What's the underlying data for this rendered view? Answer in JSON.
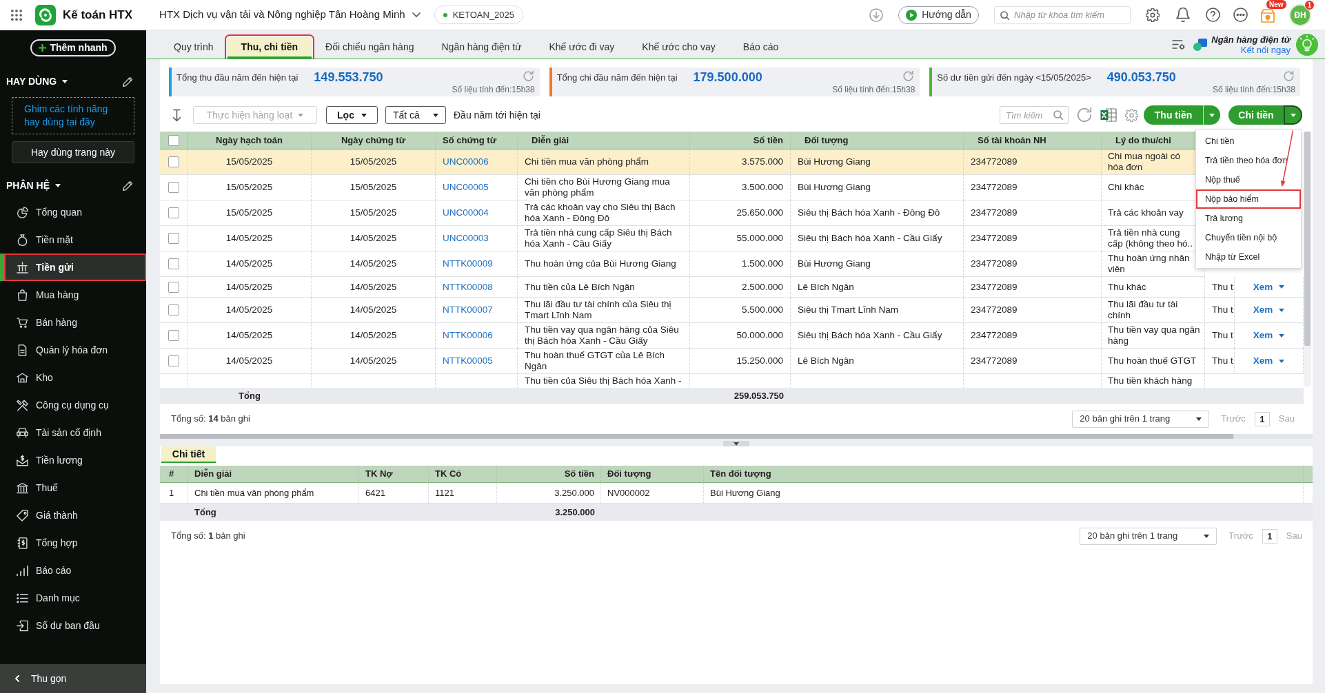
{
  "top_bar": {
    "product_name": "Kế toán HTX",
    "organization": "HTX Dịch vụ vận tải và Nông nghiệp Tân Hoàng Minh",
    "database": "KETOAN_2025",
    "guide_button": "Hướng dẫn",
    "search": {
      "placeholder": "Nhập từ khóa tìm kiếm"
    },
    "new_badge": "New",
    "avatar_initials": "ĐH",
    "notification_count": "1"
  },
  "sidebar": {
    "quick_add_button": "Thêm nhanh",
    "favorites": {
      "title": "HAY DÙNG",
      "hint": "Ghim các tính năng hay dùng tại đây",
      "pin_button": "Hay dùng trang này"
    },
    "modules": {
      "title": "PHÂN HỆ",
      "items": [
        {
          "label": "Tổng quan",
          "selected": false,
          "callout": false
        },
        {
          "label": "Tiền mặt",
          "selected": false,
          "callout": false
        },
        {
          "label": "Tiền gửi",
          "selected": true,
          "callout": true
        },
        {
          "label": "Mua hàng",
          "selected": false,
          "callout": false
        },
        {
          "label": "Bán hàng",
          "selected": false,
          "callout": false
        },
        {
          "label": "Quản lý hóa đơn",
          "selected": false,
          "callout": false
        },
        {
          "label": "Kho",
          "selected": false,
          "callout": false
        },
        {
          "label": "Công cụ dụng cụ",
          "selected": false,
          "callout": false
        },
        {
          "label": "Tài sản cố định",
          "selected": false,
          "callout": false
        },
        {
          "label": "Tiền lương",
          "selected": false,
          "callout": false
        },
        {
          "label": "Thuế",
          "selected": false,
          "callout": false
        },
        {
          "label": "Giá thành",
          "selected": false,
          "callout": false
        },
        {
          "label": "Tổng hợp",
          "selected": false,
          "callout": false
        },
        {
          "label": "Báo cáo",
          "selected": false,
          "callout": false
        },
        {
          "label": "Danh mục",
          "selected": false,
          "callout": false
        },
        {
          "label": "Số dư ban đầu",
          "selected": false,
          "callout": false
        }
      ]
    },
    "collapse_button": "Thu gọn"
  },
  "tabs": [
    {
      "label": "Quy trình",
      "selected": false,
      "callout": false
    },
    {
      "label": "Thu, chi tiền",
      "selected": true,
      "callout": true
    },
    {
      "label": "Đối chiếu ngân hàng",
      "selected": false,
      "callout": false
    },
    {
      "label": "Ngân hàng điện tử",
      "selected": false,
      "callout": false
    },
    {
      "label": "Khế ước đi vay",
      "selected": false,
      "callout": false
    },
    {
      "label": "Khế ước cho vay",
      "selected": false,
      "callout": false
    },
    {
      "label": "Báo cáo",
      "selected": false,
      "callout": false
    }
  ],
  "bank_promo": {
    "title": "Ngân hàng điện tử",
    "link": "Kết nối ngay"
  },
  "summary_cards": [
    {
      "label": "Tổng thu đầu năm đến hiện tại",
      "value": "149.553.750",
      "note": "Số liệu tính đến:15h38",
      "color": "#1ba1e6"
    },
    {
      "label": "Tổng chi đầu năm đến hiện tại",
      "value": "179.500.000",
      "note": "Số liệu tính đến:15h38",
      "color": "#f47b20"
    },
    {
      "label": "Số dư tiền gửi đến ngày <15/05/2025>",
      "value": "490.053.750",
      "note": "Số liệu tính đến:15h38",
      "color": "#4cb82e"
    }
  ],
  "toolbar": {
    "bulk_action": {
      "label": "Thực hiện hàng loạt",
      "disabled": true
    },
    "filter_button": "Lọc",
    "scope_select": "Tất cả",
    "period": "Đầu năm tới hiện tại",
    "search": {
      "placeholder": "Tìm kiếm"
    },
    "receive_button": "Thu tiền",
    "pay_button": {
      "label": "Chi tiền",
      "expanded": true
    }
  },
  "dropdown_menu": {
    "items": [
      {
        "label": "Chi tiền",
        "callout": false
      },
      {
        "label": "Trả tiền theo hóa đơn",
        "callout": false
      },
      {
        "label": "Nộp thuế",
        "callout": false
      },
      {
        "label": "Nộp bảo hiểm",
        "callout": true
      },
      {
        "label": "Trả lương",
        "callout": false
      },
      {
        "label": "Chuyển tiền nội bộ",
        "callout": false
      },
      {
        "label": "Nhập từ Excel",
        "callout": false
      }
    ]
  },
  "table": {
    "all_checked": false,
    "columns": [
      "Ngày hạch toán",
      "Ngày chứng từ",
      "Số chứng từ",
      "Diễn giải",
      "Số tiền",
      "Đối tượng",
      "Số tài khoản NH",
      "Lý do thu/chi"
    ],
    "rows": [
      {
        "selected": true,
        "checked": false,
        "posting_date": "15/05/2025",
        "document_date": "15/05/2025",
        "document_no": "UNC00006",
        "description": "Chi tiền mua văn phòng phẩm",
        "amount": "3.575.000",
        "counterparty": "Bùi Hương Giang",
        "bank_account": "234772089",
        "reason": "Chi mua ngoài có hóa đơn"
      },
      {
        "selected": false,
        "checked": false,
        "posting_date": "15/05/2025",
        "document_date": "15/05/2025",
        "document_no": "UNC00005",
        "description": "Chi tiền cho Bùi Hương Giang mua văn phòng phẩm",
        "amount": "3.500.000",
        "counterparty": "Bùi Hương Giang",
        "bank_account": "234772089",
        "reason": "Chi khác"
      },
      {
        "selected": false,
        "checked": false,
        "posting_date": "15/05/2025",
        "document_date": "15/05/2025",
        "document_no": "UNC00004",
        "description": "Trả các khoản vay cho Siêu thị Bách hóa Xanh - Đông Đô",
        "amount": "25.650.000",
        "counterparty": "Siêu thị Bách hóa Xanh - Đông Đô",
        "bank_account": "234772089",
        "reason": "Trả các khoản vay"
      },
      {
        "selected": false,
        "checked": false,
        "posting_date": "14/05/2025",
        "document_date": "14/05/2025",
        "document_no": "UNC00003",
        "description": "Trả tiền nhà cung cấp Siêu thị Bách hóa Xanh - Cầu Giấy",
        "amount": "55.000.000",
        "counterparty": "Siêu thị Bách hóa Xanh - Cầu Giấy",
        "bank_account": "234772089",
        "reason": "Trả tiền nhà cung cấp (không theo hó.."
      },
      {
        "selected": false,
        "checked": false,
        "posting_date": "14/05/2025",
        "document_date": "14/05/2025",
        "document_no": "NTTK00009",
        "description": "Thu hoàn ứng của Bùi Hương Giang",
        "amount": "1.500.000",
        "counterparty": "Bùi Hương Giang",
        "bank_account": "234772089",
        "reason": "Thu hoàn ứng nhân viên"
      },
      {
        "selected": false,
        "checked": false,
        "posting_date": "14/05/2025",
        "document_date": "14/05/2025",
        "document_no": "NTTK00008",
        "description": "Thu tiền của Lê Bích Ngân",
        "amount": "2.500.000",
        "counterparty": "Lê Bích Ngân",
        "bank_account": "234772089",
        "reason": "Thu khác",
        "column_9": "Thu t",
        "action": "Xem"
      },
      {
        "selected": false,
        "checked": false,
        "posting_date": "14/05/2025",
        "document_date": "14/05/2025",
        "document_no": "NTTK00007",
        "description": "Thu lãi đầu tư tài chính của Siêu thị Tmart Lĩnh Nam",
        "amount": "5.500.000",
        "counterparty": "Siêu thị Tmart Lĩnh Nam",
        "bank_account": "234772089",
        "reason": "Thu lãi đầu tư tài chính",
        "column_9": "Thu t",
        "action": "Xem"
      },
      {
        "selected": false,
        "checked": false,
        "posting_date": "14/05/2025",
        "document_date": "14/05/2025",
        "document_no": "NTTK00006",
        "description": "Thu tiền vay qua ngân hàng của Siêu thị Bách hóa Xanh - Cầu Giấy",
        "amount": "50.000.000",
        "counterparty": "Siêu thị Bách hóa Xanh - Cầu Giấy",
        "bank_account": "234772089",
        "reason": "Thu tiền vay qua ngân hàng",
        "column_9": "Thu t",
        "action": "Xem"
      },
      {
        "selected": false,
        "checked": false,
        "posting_date": "14/05/2025",
        "document_date": "14/05/2025",
        "document_no": "NTTK00005",
        "description": "Thu hoàn thuế GTGT của Lê Bích Ngân",
        "amount": "15.250.000",
        "counterparty": "Lê Bích Ngân",
        "bank_account": "234772089",
        "reason": "Thu hoàn thuế GTGT",
        "column_9": "Thu t",
        "action": "Xem"
      },
      {
        "selected": false,
        "description": "Thu tiền của Siêu thị Bách hóa Xanh -",
        "reason": "Thu tiền khách hàng"
      }
    ],
    "total_label": "Tổng",
    "total_amount": "259.053.750",
    "record_count": "Tổng số: **14** bản ghi",
    "pagination": {
      "page_size": "20 bản ghi trên 1 trang",
      "previous": "Trước",
      "page": "1",
      "next": "Sau"
    }
  },
  "detail": {
    "tab": {
      "label": "Chi tiết",
      "selected": true
    },
    "columns": [
      "#",
      "Diễn giải",
      "TK Nợ",
      "TK Có",
      "Số tiền",
      "Đối tượng",
      "Tên đối tượng"
    ],
    "rows": [
      {
        "number": "1",
        "description": "Chi tiền mua văn phòng phẩm",
        "debit_account": "6421",
        "credit_account": "1121",
        "amount": "3.250.000",
        "counterparty_code": "NV000002",
        "counterparty_name": "Bùi Hương Giang"
      }
    ],
    "total_label": "Tổng",
    "total_amount": "3.250.000",
    "record_count": "Tổng số: **1** bản ghi",
    "pagination": {
      "page_size": "20 bản ghi trên 1 trang",
      "previous": "Trước",
      "page": "1",
      "next": "Sau"
    }
  }
}
